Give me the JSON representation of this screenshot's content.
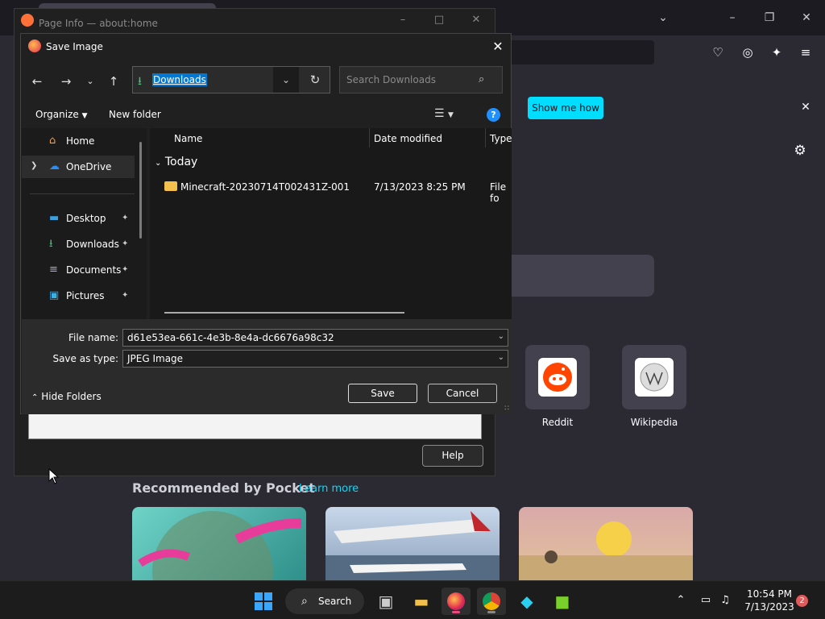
{
  "pageinfo": {
    "title": "Page Info — about:home",
    "help_label": "Help"
  },
  "firefox": {
    "notification_button": "Show me how",
    "topsites": [
      {
        "label": "Reddit"
      },
      {
        "label": "Wikipedia"
      }
    ],
    "pocket_title": "Recommended by Pocket",
    "pocket_learn_more": "Learn more"
  },
  "dialog": {
    "title": "Save Image",
    "address": "Downloads",
    "search_placeholder": "Search Downloads",
    "organize_label": "Organize",
    "new_folder_label": "New folder",
    "help_glyph": "?",
    "nav_items": [
      {
        "label": "Home"
      },
      {
        "label": "OneDrive"
      },
      {
        "label": "Desktop"
      },
      {
        "label": "Downloads"
      },
      {
        "label": "Documents"
      },
      {
        "label": "Pictures"
      }
    ],
    "columns": {
      "name": "Name",
      "date_modified": "Date modified",
      "type": "Type"
    },
    "group_today": "Today",
    "files": [
      {
        "name": "Minecraft-20230714T002431Z-001",
        "date": "7/13/2023 8:25 PM",
        "type": "File fo"
      }
    ],
    "file_name_label": "File name:",
    "file_name_value": "d61e53ea-661c-4e3b-8e4a-dc6676a98c32",
    "save_type_label": "Save as type:",
    "save_type_value": "JPEG Image",
    "hide_folders_label": "Hide Folders",
    "save_label": "Save",
    "cancel_label": "Cancel"
  },
  "taskbar": {
    "search_label": "Search",
    "time": "10:54 PM",
    "date": "7/13/2023",
    "notifications": "2"
  },
  "colors": {
    "accent_blue": "#0078d4",
    "firefox_cyan": "#00ddff"
  }
}
